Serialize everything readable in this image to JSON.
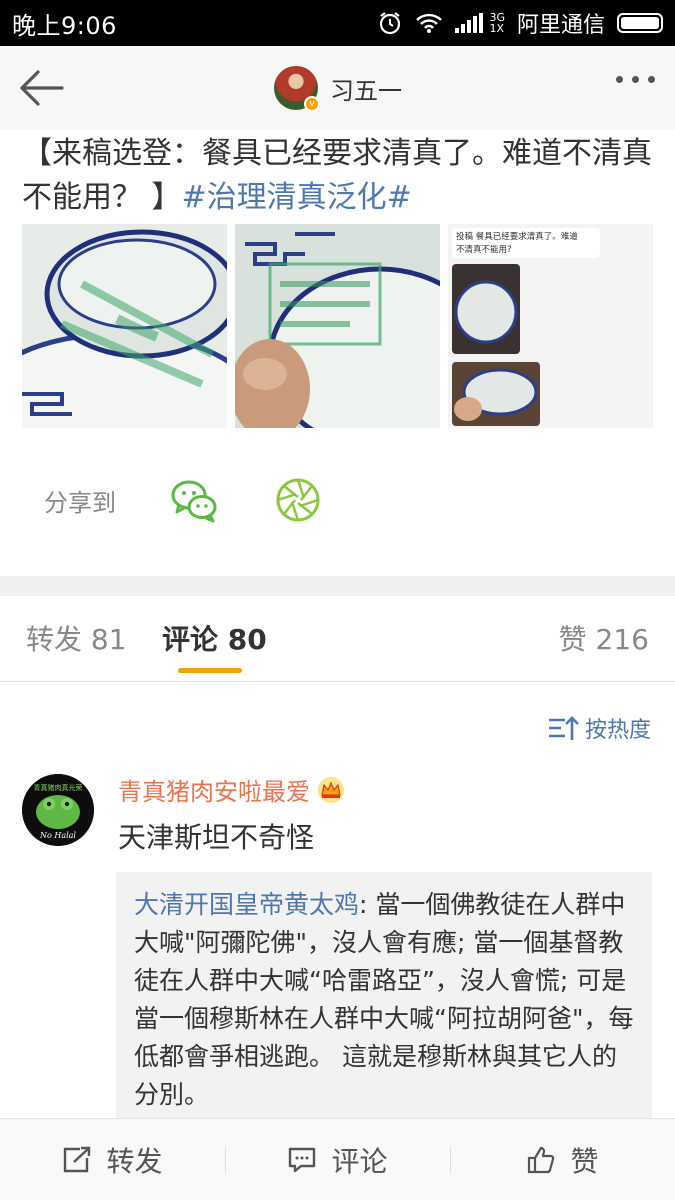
{
  "status_bar": {
    "time": "晚上9:06",
    "network_top": "3G",
    "network_bottom": "1X",
    "carrier": "阿里通信"
  },
  "nav": {
    "username": "习五一",
    "back_icon": "back-arrow-icon",
    "more_icon": "more-dots-icon"
  },
  "post": {
    "text": "【来稿选登：餐具已经要求清真了。难道不清真不能用？ 】",
    "hashtag": "#治理清真泛化#",
    "photo3_caption": "投稿 餐具已经要求清真了。难道不清真不能用?"
  },
  "share": {
    "label": "分享到",
    "icons": [
      "wechat-icon",
      "moments-icon"
    ]
  },
  "tabs": {
    "repost_label": "转发",
    "repost_count": "81",
    "comment_label": "评论",
    "comment_count": "80",
    "like_label": "赞",
    "like_count": "216"
  },
  "sort": {
    "label": "按热度"
  },
  "comment": {
    "username": "青真猪肉安啦最爱",
    "text": "天津斯坦不奇怪",
    "avatar_text_top": "青真猪肉真光荣",
    "avatar_text_bottom": "No Halal",
    "quote_username": "大清开国皇帝黄太鸡",
    "quote_text": ": 當一個佛教徒在人群中大喊\"阿彌陀佛\"，沒人會有應; 當一個基督教徒在人群中大喊“哈雷路亞”，沒人會慌; 可是當一個穆斯林在人群中大喊“阿拉胡阿爸\"，每低都會爭相逃跑。 這就是穆斯林與其它人的分別。"
  },
  "bottom_bar": {
    "repost": "转发",
    "comment": "评论",
    "like": "赞"
  },
  "colors": {
    "accent": "#f5a10b",
    "link": "#4d78ad",
    "username": "#eb7350"
  }
}
